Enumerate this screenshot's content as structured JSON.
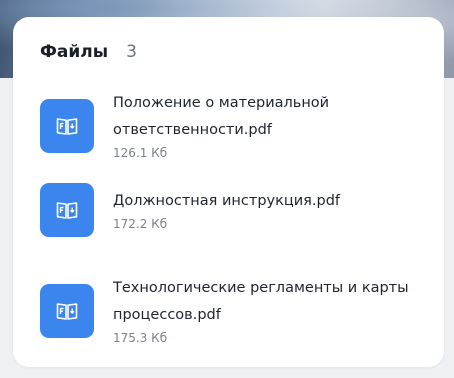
{
  "files_panel": {
    "title": "Файлы",
    "count": "3",
    "items": [
      {
        "name": "Положение о материальной ответственности.pdf",
        "size": "126.1 Кб",
        "icon": "pdf-file-icon"
      },
      {
        "name": "Должностная инструкция.pdf",
        "size": "172.2 Кб",
        "icon": "pdf-file-icon"
      },
      {
        "name": "Технологические регламенты и карты процессов.pdf",
        "size": "175.3 Кб",
        "icon": "pdf-file-icon"
      }
    ]
  },
  "colors": {
    "accent": "#3b86ee",
    "card_background": "#ffffff",
    "page_background": "#eef0f3",
    "title_text": "#1b1f2a",
    "secondary_text": "#7b8190"
  }
}
